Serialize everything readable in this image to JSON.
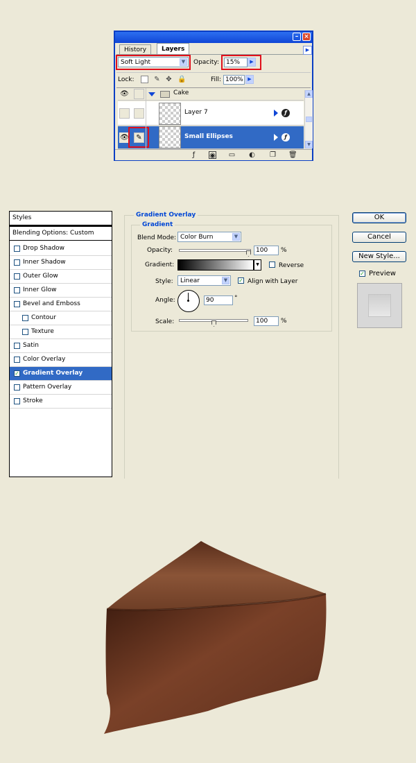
{
  "layers_panel": {
    "tabs": [
      "History",
      "Layers"
    ],
    "blend_mode": "Soft Light",
    "opacity_label": "Opacity:",
    "opacity_value": "15%",
    "lock_label": "Lock:",
    "fill_label": "Fill:",
    "fill_value": "100%",
    "group_name": "Cake",
    "layers": [
      {
        "name": "Layer 7",
        "visible": false,
        "selected": false
      },
      {
        "name": "Small Ellipses",
        "visible": true,
        "selected": true
      }
    ]
  },
  "layer_style": {
    "styles_header": "Styles",
    "blending_options": "Blending Options: Custom",
    "effects": [
      {
        "label": "Drop Shadow",
        "checked": false,
        "indent": false,
        "selected": false
      },
      {
        "label": "Inner Shadow",
        "checked": false,
        "indent": false,
        "selected": false
      },
      {
        "label": "Outer Glow",
        "checked": false,
        "indent": false,
        "selected": false
      },
      {
        "label": "Inner Glow",
        "checked": false,
        "indent": false,
        "selected": false
      },
      {
        "label": "Bevel and Emboss",
        "checked": false,
        "indent": false,
        "selected": false
      },
      {
        "label": "Contour",
        "checked": false,
        "indent": true,
        "selected": false
      },
      {
        "label": "Texture",
        "checked": false,
        "indent": true,
        "selected": false
      },
      {
        "label": "Satin",
        "checked": false,
        "indent": false,
        "selected": false
      },
      {
        "label": "Color Overlay",
        "checked": false,
        "indent": false,
        "selected": false
      },
      {
        "label": "Gradient Overlay",
        "checked": true,
        "indent": false,
        "selected": true
      },
      {
        "label": "Pattern Overlay",
        "checked": false,
        "indent": false,
        "selected": false
      },
      {
        "label": "Stroke",
        "checked": false,
        "indent": false,
        "selected": false
      }
    ],
    "section_title": "Gradient Overlay",
    "subsection_title": "Gradient",
    "blend_mode_label": "Blend Mode:",
    "blend_mode_value": "Color Burn",
    "opacity_label": "Opacity:",
    "opacity_value": "100",
    "opacity_unit": "%",
    "opacity_level": 1.0,
    "gradient_label": "Gradient:",
    "reverse_label": "Reverse",
    "reverse_checked": false,
    "style_label": "Style:",
    "style_value": "Linear",
    "align_label": "Align with Layer",
    "align_checked": true,
    "angle_label": "Angle:",
    "angle_value": "90",
    "angle_unit": "°",
    "scale_label": "Scale:",
    "scale_value": "100",
    "scale_unit": "%",
    "scale_level": 0.5,
    "buttons": {
      "ok": "OK",
      "cancel": "Cancel",
      "new_style": "New Style..."
    },
    "preview_label": "Preview",
    "preview_checked": true
  },
  "colors": {
    "xp_blue": "#0a3ec4",
    "selection": "#316ac5",
    "highlight_red": "#e0101c",
    "cake_brown": "#6b3a24"
  }
}
